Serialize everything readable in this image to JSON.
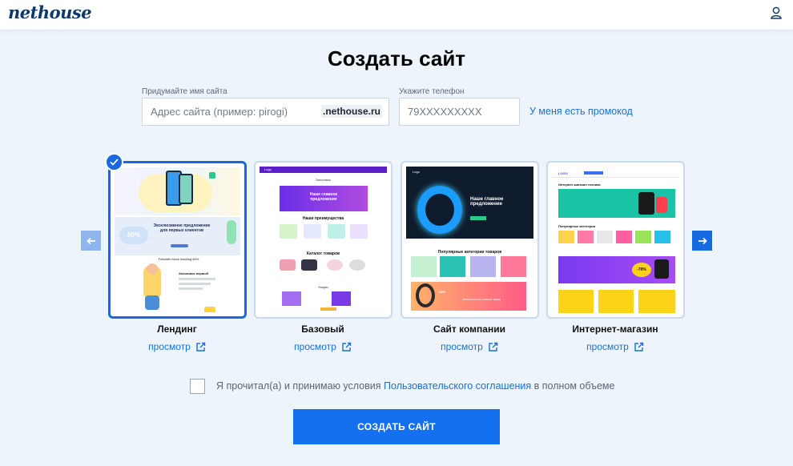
{
  "header": {
    "logo": "nethouse"
  },
  "title": "Создать сайт",
  "form": {
    "site_name_label": "Придумайте имя сайта",
    "site_name_placeholder": "Адрес сайта (пример: pirogi)",
    "domain_suffix": ".nethouse.ru",
    "phone_label": "Укажите телефон",
    "phone_placeholder": "79XXXXXXXXX",
    "promo_link": "У меня есть промокод"
  },
  "templates": [
    {
      "name": "Лендинг",
      "preview": "просмотр",
      "selected": true,
      "thumb": {
        "texts": [
          "Эксклюзивное предложение для первых клиентов",
          "50%",
          "Fullwidth block heading 80%",
          "Заголовок первый"
        ]
      }
    },
    {
      "name": "Базовый",
      "preview": "просмотр",
      "selected": false,
      "thumb": {
        "texts": [
          "Logo",
          "Заголовок",
          "Наше главное предложение",
          "Наши преимущества",
          "Каталог товаров",
          "Услуги"
        ]
      }
    },
    {
      "name": "Сайт компании",
      "preview": "просмотр",
      "selected": false,
      "thumb": {
        "texts": [
          "Logo",
          "Наше главное предложение",
          "Популярные категории товаров",
          "-40%",
          "Записаться на главные акции"
        ]
      }
    },
    {
      "name": "Интернет-магазин",
      "preview": "просмотр",
      "selected": false,
      "thumb": {
        "texts": [
          "LOGO",
          "Интернет-магазин техники",
          "Популярные категории",
          "-70%"
        ]
      }
    }
  ],
  "terms": {
    "before": "Я прочитал(а) и принимаю условия ",
    "link": "Пользовательского соглашения",
    "after": " в полном объеме"
  },
  "submit_label": "СОЗДАТЬ САЙТ",
  "colors": {
    "accent": "#1769e0",
    "page_bg": "#edf4fb",
    "link": "#1a6ed8"
  }
}
